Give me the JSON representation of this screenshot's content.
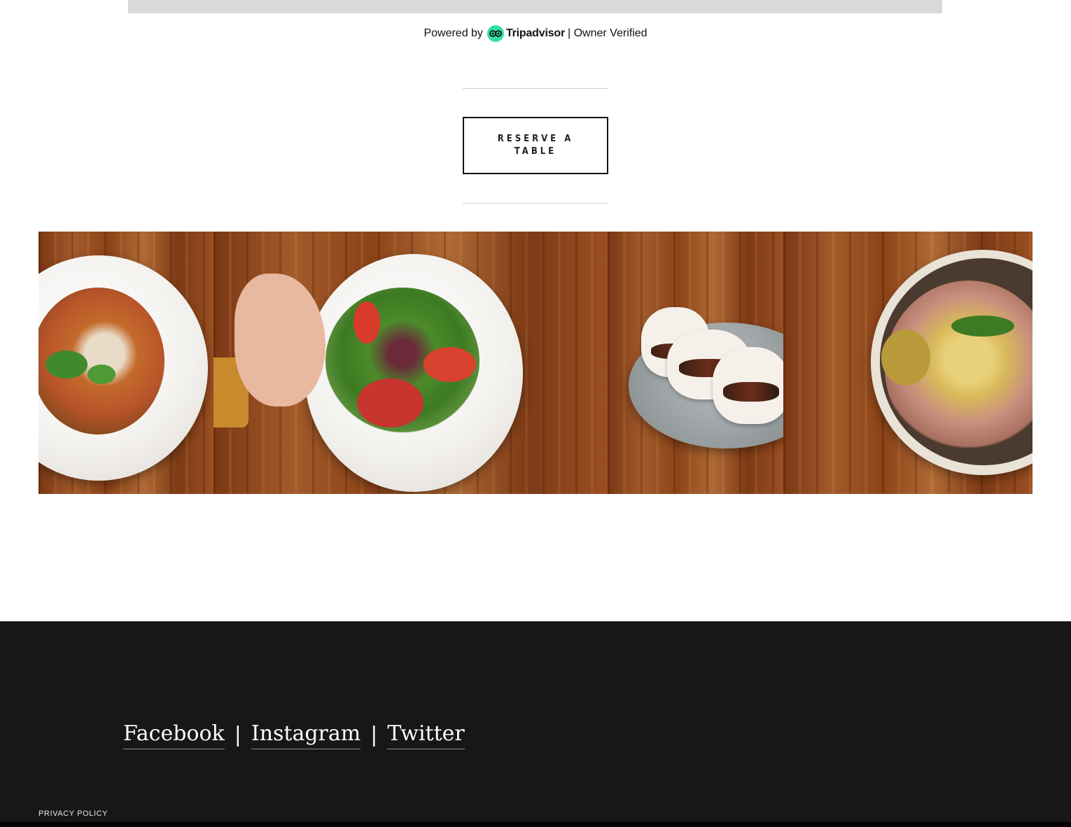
{
  "widget": {
    "powered_by": "Powered by",
    "brand": "Tripadvisor",
    "verified": "| Owner Verified",
    "brand_color": "#34e0a1"
  },
  "cta": {
    "reserve_label": "RESERVE A TABLE"
  },
  "gallery": {
    "images": [
      {
        "name": "pasta-dish-photo"
      },
      {
        "name": "salad-plate-photo"
      },
      {
        "name": "bao-buns-photo"
      },
      {
        "name": "potato-bowl-photo"
      }
    ]
  },
  "footer": {
    "social": [
      {
        "label": "Facebook"
      },
      {
        "label": "Instagram"
      },
      {
        "label": "Twitter"
      }
    ],
    "separator": "|",
    "privacy": "PRIVACY POLICY",
    "background": "#171717"
  }
}
